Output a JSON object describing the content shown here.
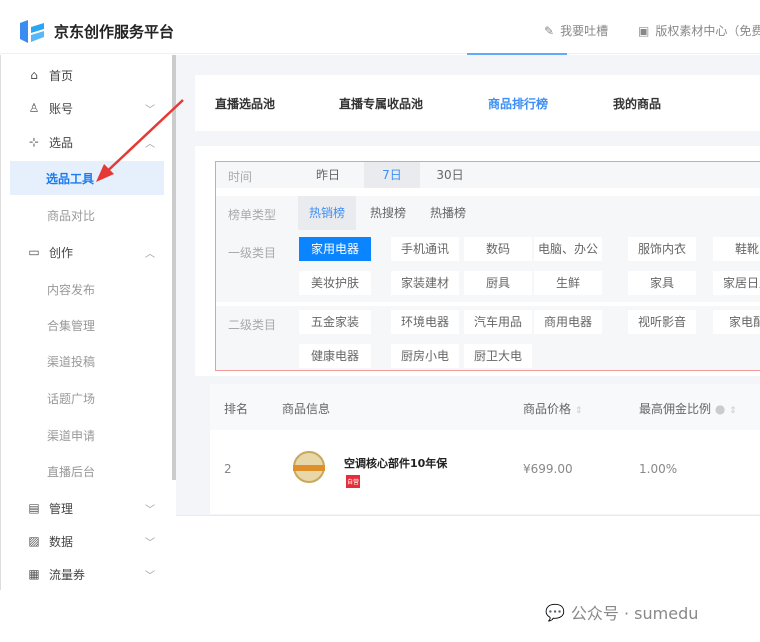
{
  "header": {
    "brand": "京东创作服务平台",
    "feedback": "我要吐槽",
    "copyright": "版权素材中心（免费"
  },
  "sidebar": {
    "items": [
      {
        "label": "首页",
        "icon": "home-icon"
      },
      {
        "label": "账号",
        "icon": "user-icon"
      },
      {
        "label": "选品",
        "icon": "scan-icon"
      },
      {
        "label": "选品工具",
        "active": true
      },
      {
        "label": "商品对比"
      },
      {
        "label": "创作",
        "icon": "folder-icon"
      },
      {
        "label": "内容发布"
      },
      {
        "label": "合集管理"
      },
      {
        "label": "渠道投稿"
      },
      {
        "label": "话题广场"
      },
      {
        "label": "渠道申请"
      },
      {
        "label": "直播后台"
      },
      {
        "label": "管理",
        "icon": "list-icon"
      },
      {
        "label": "数据",
        "icon": "chart-icon"
      },
      {
        "label": "流量券",
        "icon": "ticket-icon"
      }
    ]
  },
  "tabs": [
    "直播选品池",
    "直播专属收品池",
    "商品排行榜",
    "我的商品"
  ],
  "filters": {
    "time": {
      "label": "时间",
      "options": [
        "昨日",
        "7日",
        "30日"
      ],
      "selected": "7日"
    },
    "type": {
      "label": "榜单类型",
      "options": [
        "热销榜",
        "热搜榜",
        "热播榜"
      ],
      "selected": "热销榜"
    },
    "cat1": {
      "label": "一级类目",
      "options": [
        "家用电器",
        "手机通讯",
        "数码",
        "电脑、办公",
        "服饰内衣",
        "鞋靴",
        "美妆护肤",
        "家装建材",
        "厨具",
        "生鲜",
        "家具",
        "家居日用"
      ],
      "selected": "家用电器"
    },
    "cat2": {
      "label": "二级类目",
      "options": [
        "五金家装",
        "环境电器",
        "汽车用品",
        "商用电器",
        "视听影音",
        "家电配",
        "健康电器",
        "厨房小电",
        "厨卫大电"
      ]
    }
  },
  "table": {
    "headers": [
      "排名",
      "商品信息",
      "商品价格",
      "最高佣金比例"
    ],
    "rows": [
      {
        "rank": "2",
        "name": "空调核心部件10年保",
        "badge": "自营",
        "price": "¥699.00",
        "commission": "1.00%"
      }
    ]
  },
  "watermark": "公众号 · sumedu",
  "colors": {
    "accent": "#0a84ff",
    "annotation": "#e53935"
  }
}
